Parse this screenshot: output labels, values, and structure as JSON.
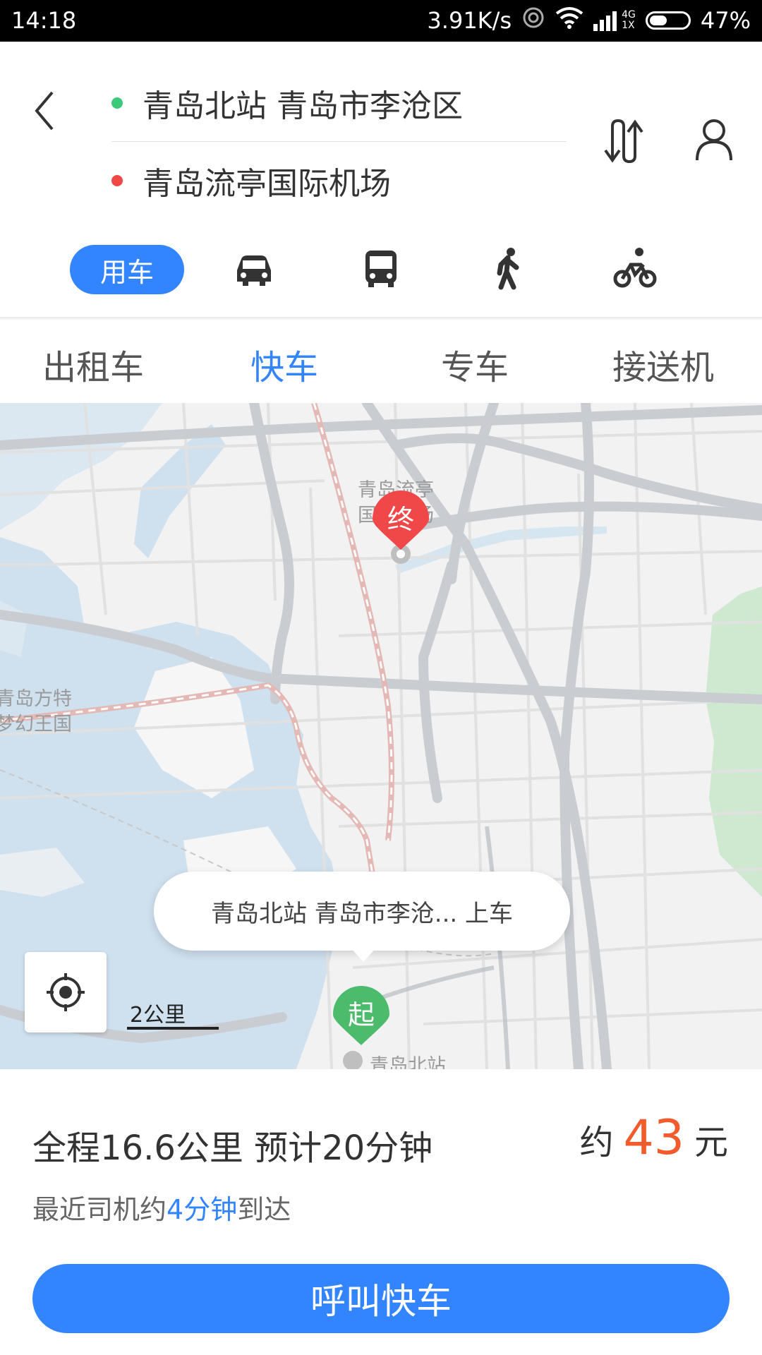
{
  "status_bar": {
    "time": "14:18",
    "speed": "3.91K/s",
    "network": "4G",
    "network_sub": "1X",
    "battery": "47%",
    "battery_level": 0.47
  },
  "route": {
    "start": "青岛北站 青岛市李沧区",
    "end": "青岛流亭国际机场",
    "start_color": "#3cc97a",
    "end_color": "#f04848"
  },
  "modes": {
    "active_label": "用车",
    "icons": [
      "car-icon",
      "bus-icon",
      "walk-icon",
      "bike-icon"
    ]
  },
  "tabs": [
    "出租车",
    "快车",
    "专车",
    "接送机"
  ],
  "active_tab": 1,
  "map": {
    "end_marker": "终",
    "start_marker": "起",
    "end_place_line1": "青岛流亭",
    "end_place_line2": "国际机场",
    "left_place_line1": "青岛方特",
    "left_place_line2": "梦幻王国",
    "start_place": "青岛北站",
    "pickup_callout": "青岛北站 青岛市李沧... 上车",
    "scale": "2公里"
  },
  "trip": {
    "summary": "全程16.6公里 预计20分钟",
    "eta_prefix": "最近司机约",
    "eta_highlight": "4分钟",
    "eta_suffix": "到达",
    "price_prefix": "约",
    "price_value": "43",
    "price_unit": "元"
  },
  "call_button": "呼叫快车",
  "colors": {
    "accent": "#3385ff",
    "price": "#f25c2d",
    "marker_end": "#f04848",
    "marker_start": "#4cbb6c"
  }
}
